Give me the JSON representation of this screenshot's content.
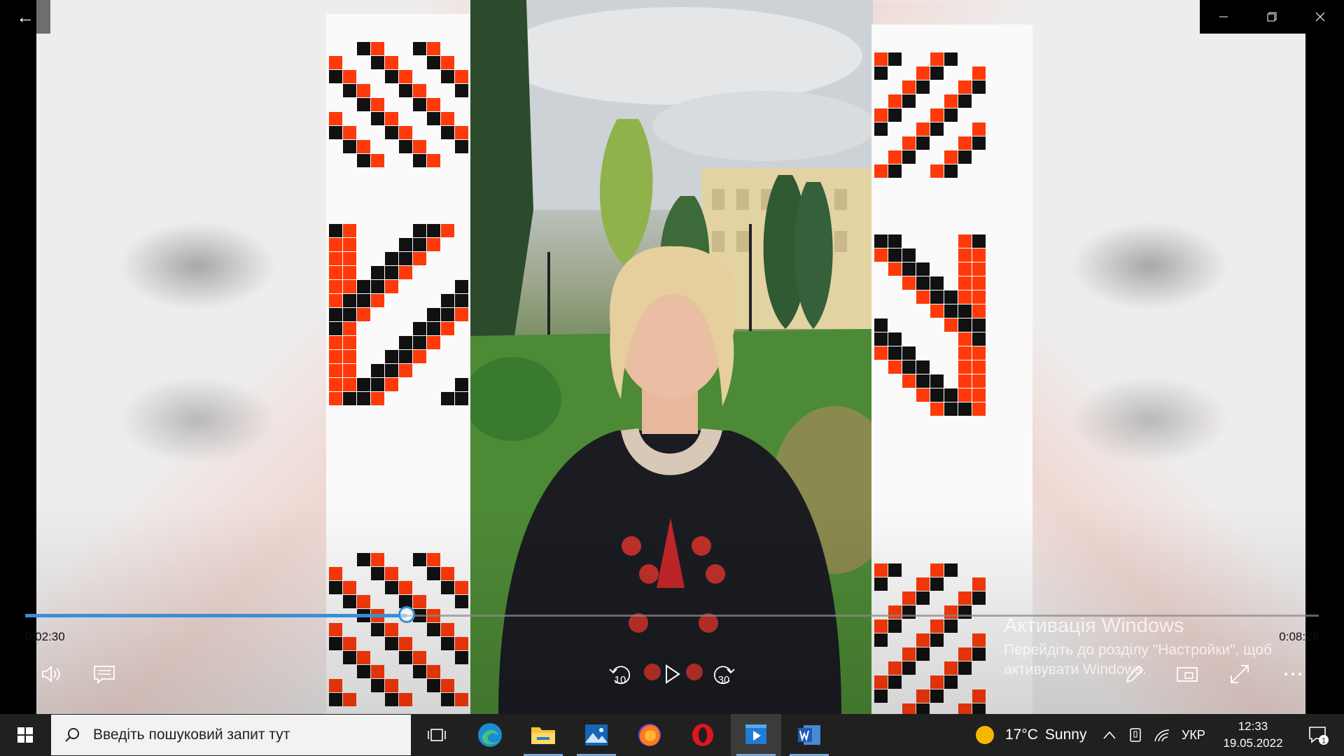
{
  "player": {
    "current_time": "0:02:30",
    "duration": "0:08:29",
    "progress": 0.295,
    "skip_back": "10",
    "skip_forward": "30"
  },
  "activation": {
    "title": "Активація Windows",
    "subtitle": "Перейдіть до розділу \"Настройки\", щоб активувати Windows."
  },
  "taskbar": {
    "search_placeholder": "Введіть пошуковий запит тут",
    "weather_temp": "17°C",
    "weather_desc": "Sunny",
    "language": "УКР",
    "time": "12:33",
    "date": "19.05.2022",
    "notification_count": "1",
    "apps": [
      "task-view",
      "edge",
      "file-explorer",
      "photos",
      "firefox",
      "opera",
      "movies-tv",
      "word"
    ]
  },
  "colors": {
    "accent": "#3a8ed6",
    "ornament_red": "#ff3a0a",
    "ornament_black": "#111111"
  }
}
